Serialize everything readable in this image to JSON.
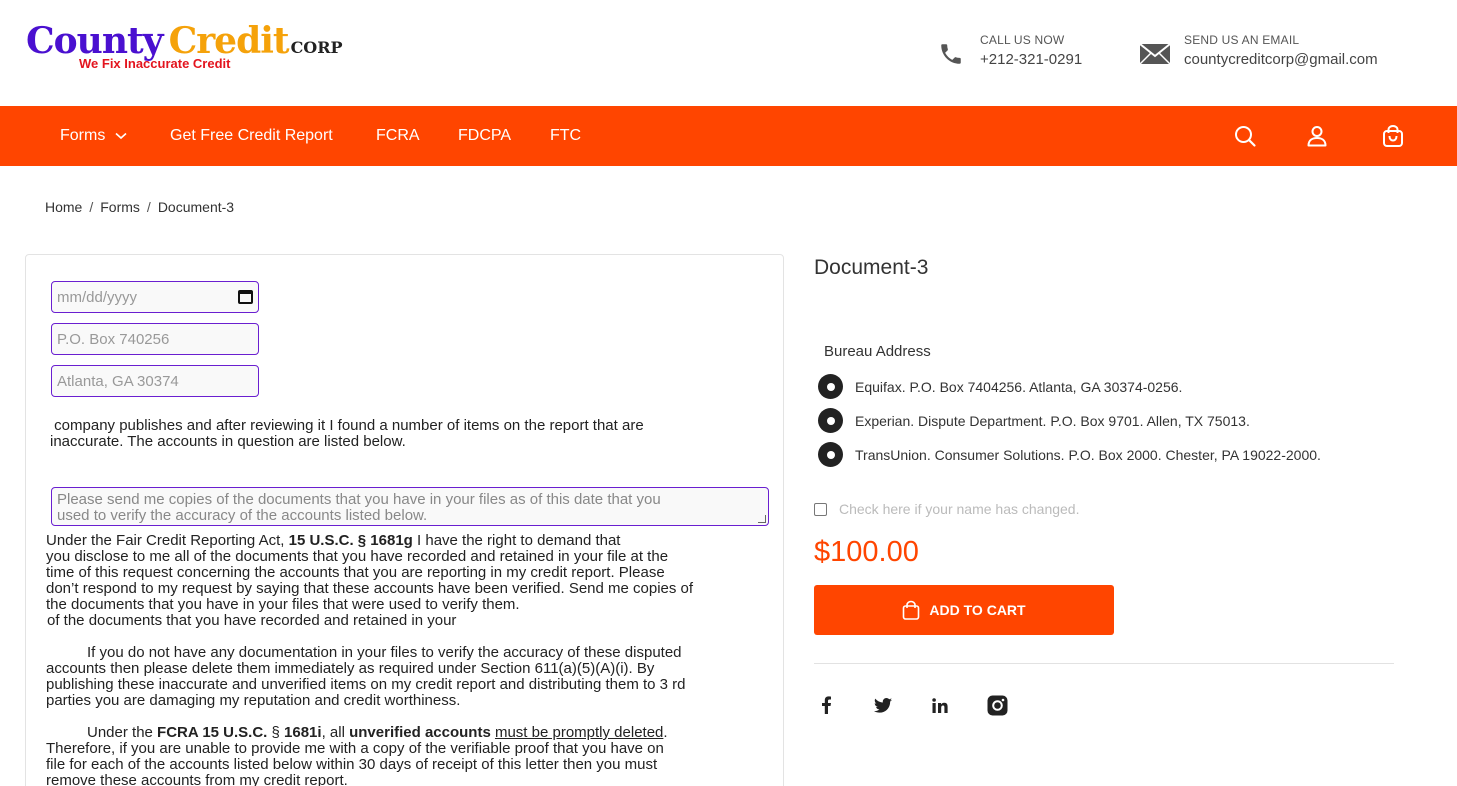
{
  "brand": {
    "name_part1": "County",
    "name_part2": "Credit",
    "name_suffix": "CORP",
    "tagline": "We Fix Inaccurate Credit"
  },
  "contact": {
    "phone_label": "CALL US NOW",
    "phone_value": "+212-321-0291",
    "email_label": "SEND US AN EMAIL",
    "email_value": "countycreditcorp@gmail.com"
  },
  "nav": {
    "items": [
      {
        "label": "Forms"
      },
      {
        "label": "Get Free Credit Report"
      },
      {
        "label": "FCRA"
      },
      {
        "label": "FDCPA"
      },
      {
        "label": "FTC"
      }
    ],
    "icons": [
      "search-icon",
      "user-icon",
      "shopping-bag-icon"
    ]
  },
  "breadcrumb": {
    "home": "Home",
    "forms": "Forms",
    "current": "Document-3",
    "separator": "/"
  },
  "form": {
    "date_placeholder": "mm/dd/yyyy",
    "address_line1": "P.O. Box 740256",
    "address_line2": "Atlanta, GA 30374",
    "intro_line1": "company publishes and after reviewing it I found a number of items on the report that are",
    "intro_line2": "inaccurate. The accounts in question are listed below.",
    "textarea_line1": "Please send me copies of the documents that you have in your files as of this date that you",
    "textarea_line2": "used to verify the accuracy of the accounts listed below.",
    "p1_a": "Under the Fair Credit Reporting Act, ",
    "p1_b": "15 U.S.C. § 1681g",
    "p1_c": " I have the right to demand that",
    "p1_l2": "you disclose to me all of the documents that you have recorded and retained in your file at the",
    "p1_l3": "time of this request concerning the accounts that you are reporting in my credit report. Please",
    "p1_l4": "don’t respond to my request by saying that these accounts have been verified. Send me copies of",
    "p1_l5": "the documents that you have in your files that were used to verify them.",
    "p1_l6": "of the documents that you have recorded and retained in your",
    "p2_l1": "If you do not have any documentation in your files to verify the accuracy of these disputed",
    "p2_l2": "accounts then please delete them immediately as required under Section 611(a)(5)(A)(i). By",
    "p2_l3": "publishing these inaccurate and unverified items on my credit report and distributing them to 3 rd",
    "p2_l4": "parties you are damaging my reputation and credit worthiness.",
    "p3_a": "Under the ",
    "p3_b": "FCRA 15 U.S.C.",
    "p3_c": " § ",
    "p3_d": "1681i",
    "p3_e": ", all ",
    "p3_f": "unverified accounts",
    "p3_g": " ",
    "p3_h": "must be promptly deleted",
    "p3_i": ".",
    "p3_l2": "Therefore, if you are unable to provide me with a copy of the verifiable proof that you have on",
    "p3_l3": "file for each of the accounts listed below within 30 days of receipt of this letter then you must",
    "p3_l4": "remove these accounts from my credit report."
  },
  "product": {
    "title": "Document-3",
    "bureau_label": "Bureau Address",
    "bureaus": [
      "Equifax. P.O. Box 7404256. Atlanta, GA 30374-0256.",
      "Experian. Dispute Department. P.O. Box 9701. Allen, TX 75013.",
      "TransUnion. Consumer Solutions. P.O. Box 2000. Chester, PA 19022-2000."
    ],
    "name_change_label": "Check here if your name has changed.",
    "price": "$100.00",
    "add_to_cart": "ADD TO CART",
    "social": [
      "facebook-icon",
      "twitter-icon",
      "linkedin-icon",
      "instagram-icon"
    ]
  },
  "colors": {
    "accent": "#ff4500",
    "field_border": "#6a1fd0",
    "logo_purple": "#4a10d0",
    "logo_orange": "#f5a20a",
    "tagline_red": "#e3141e"
  }
}
